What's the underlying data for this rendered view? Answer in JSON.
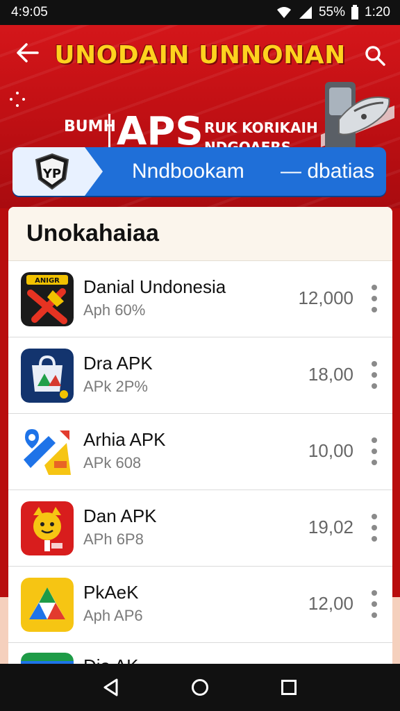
{
  "status_bar": {
    "time_left": "4:9:05",
    "battery": "55%",
    "time_right": "1:20",
    "icons": [
      "wifi-icon",
      "signal-icon",
      "battery-icon"
    ]
  },
  "header": {
    "title": "UNODAIN UNNONAN",
    "banner_left": "BUMH",
    "banner_main": "APS",
    "banner_sub_line1": "RUK KORIKAIH",
    "banner_sub_line2": "NDGOAERS",
    "icons": [
      "back-arrow-icon",
      "search-icon",
      "sparkle-icon",
      "train-icon"
    ]
  },
  "tab_bar": {
    "label": "Nndbookam",
    "sub_label": "— dbatias",
    "logo_text": "YP"
  },
  "list": {
    "title": "Unokahaiaa",
    "items": [
      {
        "name": "Danial Undonesia",
        "sub": "Aph 60%",
        "count": "12,000",
        "icon": "tools-icon",
        "icon_text": "ANIGR"
      },
      {
        "name": "Dra APK",
        "sub": "APk 2P%",
        "count": "18,00",
        "icon": "bag-icon",
        "icon_text": ""
      },
      {
        "name": "Arhia APK",
        "sub": "APk 608",
        "count": "10,00",
        "icon": "map-pin-icon",
        "icon_text": ""
      },
      {
        "name": "Dan APK",
        "sub": "APh 6P8",
        "count": "19,02",
        "icon": "cat-icon",
        "icon_text": ""
      },
      {
        "name": "PkAeK",
        "sub": "Aph AP6",
        "count": "12,00",
        "icon": "drive-icon",
        "icon_text": ""
      },
      {
        "name": "Dia AK",
        "sub": "",
        "count": "",
        "icon": "app-icon",
        "icon_text": ""
      }
    ]
  },
  "nav_bar": {
    "icons": [
      "back-triangle-icon",
      "home-circle-icon",
      "recents-square-icon"
    ]
  },
  "colors": {
    "header_red": "#c21014",
    "title_yellow": "#ffd21f",
    "tab_blue": "#1f6fd8"
  }
}
